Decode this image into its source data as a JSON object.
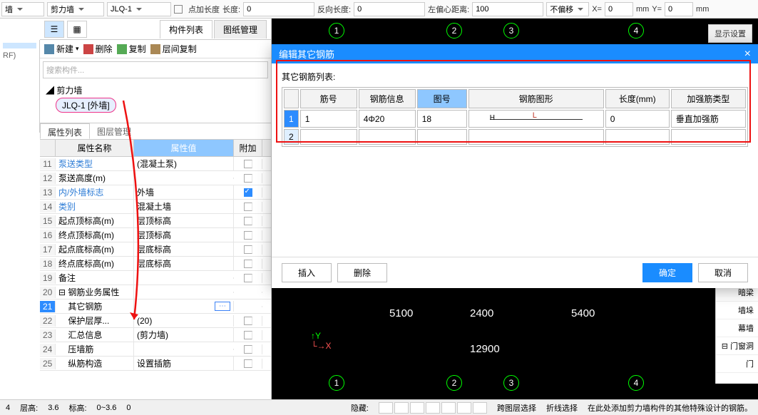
{
  "topbar": {
    "dd1": "墙",
    "dd2": "剪力墙",
    "dd3": "JLQ-1",
    "chk_point": "点加长度",
    "len_lbl": "长度:",
    "len_val": "0",
    "rev_lbl": "反向长度:",
    "rev_val": "0",
    "ecc_lbl": "左偏心距离:",
    "ecc_val": "100",
    "offset": "不偏移",
    "x_lbl": "X=",
    "x_val": "0",
    "mm1": "mm",
    "y_lbl": "Y=",
    "y_val": "0",
    "mm2": "mm"
  },
  "display_settings": "显示设置",
  "tabs": {
    "t1": "构件列表",
    "t2": "图纸管理"
  },
  "toolbar": {
    "new": "新建",
    "del": "删除",
    "copy": "复制",
    "copy2": "层间复制"
  },
  "search_ph": "搜索构件...",
  "tree": {
    "root": "剪力墙",
    "item1": "JLQ-1 [外墙]"
  },
  "left_narrow": {
    "i1": "",
    "i2": "RF)"
  },
  "prop_tabs": {
    "t1": "属性列表",
    "t2": "图层管理"
  },
  "prop_header": {
    "name": "属性名称",
    "value": "属性值",
    "attach": "附加"
  },
  "props": [
    {
      "n": "11",
      "name": "泵送类型",
      "val": "(混凝土泵)",
      "link": true
    },
    {
      "n": "12",
      "name": "泵送高度(m)",
      "val": ""
    },
    {
      "n": "13",
      "name": "内/外墙标志",
      "val": "外墙",
      "link": true,
      "checked": true
    },
    {
      "n": "14",
      "name": "类别",
      "val": "混凝土墙",
      "link": true
    },
    {
      "n": "15",
      "name": "起点顶标高(m)",
      "val": "层顶标高"
    },
    {
      "n": "16",
      "name": "终点顶标高(m)",
      "val": "层顶标高"
    },
    {
      "n": "17",
      "name": "起点底标高(m)",
      "val": "层底标高"
    },
    {
      "n": "18",
      "name": "终点底标高(m)",
      "val": "层底标高"
    },
    {
      "n": "19",
      "name": "备注",
      "val": ""
    },
    {
      "n": "20",
      "name": "钢筋业务属性",
      "val": "",
      "collapse": true
    },
    {
      "n": "21",
      "name": "其它钢筋",
      "val": "",
      "selected": true,
      "dots": true
    },
    {
      "n": "22",
      "name": "保护层厚...",
      "val": "(20)"
    },
    {
      "n": "23",
      "name": "汇总信息",
      "val": "(剪力墙)"
    },
    {
      "n": "24",
      "name": "压墙筋",
      "val": ""
    },
    {
      "n": "25",
      "name": "纵筋构造",
      "val": "设置插筋"
    }
  ],
  "dialog": {
    "title": "编辑其它钢筋",
    "list_label": "其它钢筋列表:",
    "headers": {
      "h1": "筋号",
      "h2": "钢筋信息",
      "h3": "图号",
      "h4": "钢筋图形",
      "h5": "长度(mm)",
      "h6": "加强筋类型"
    },
    "rows": [
      {
        "rn": "1",
        "no": "1",
        "info": "4Φ20",
        "fig": "18",
        "len": "0",
        "type": "垂直加强筋"
      },
      {
        "rn": "2",
        "no": "",
        "info": "",
        "fig": "",
        "len": "",
        "type": ""
      }
    ],
    "shape_h": "H",
    "shape_l": "L",
    "btn_insert": "插入",
    "btn_delete": "删除",
    "btn_ok": "确定",
    "btn_cancel": "取消"
  },
  "canvas": {
    "markers_top": [
      "1",
      "2",
      "3",
      "4"
    ],
    "markers_bot": [
      "1",
      "2",
      "3",
      "4"
    ],
    "dims": {
      "d1": "5100",
      "d2": "2400",
      "d3": "5400",
      "total": "12900"
    },
    "cy": "Y",
    "cx": "X"
  },
  "right": [
    "暗梁",
    "墙垛",
    "幕墙",
    "门窗洞",
    "门"
  ],
  "status": {
    "s1": "4",
    "floor_lbl": "层高:",
    "floor_val": "3.6",
    "elev_lbl": "标高:",
    "elev_val": "0~3.6",
    "zero": "0",
    "hide_lbl": "隐藏:",
    "cross": "跨图层选择",
    "fold": "折线选择",
    "hint": "在此处添加剪力墙构件的其他特殊设计的钢筋。"
  }
}
